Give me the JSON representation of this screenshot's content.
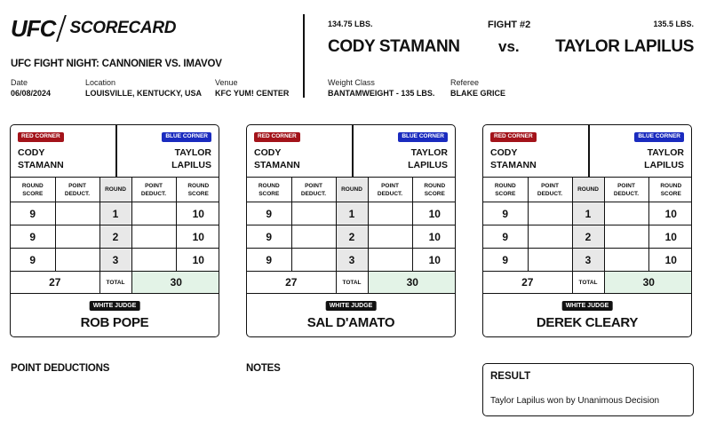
{
  "brand": {
    "logo": "UFC",
    "section": "SCORECARD"
  },
  "event": {
    "title": "UFC FIGHT NIGHT: CANNONIER VS. IMAVOV",
    "date_label": "Date",
    "date": "06/08/2024",
    "location_label": "Location",
    "location": "LOUISVILLE, KENTUCKY, USA",
    "venue_label": "Venue",
    "venue": "KFC YUM! CENTER"
  },
  "fight": {
    "number": "FIGHT #2",
    "vs": "vs.",
    "red": {
      "name": "CODY STAMANN",
      "weight": "134.75 LBS."
    },
    "blue": {
      "name": "TAYLOR LAPILUS",
      "weight": "135.5 LBS."
    },
    "weight_class_label": "Weight Class",
    "weight_class": "BANTAMWEIGHT - 135 LBS.",
    "referee_label": "Referee",
    "referee": "BLAKE GRICE"
  },
  "labels": {
    "red_corner": "RED CORNER",
    "blue_corner": "BLUE CORNER",
    "red_first": "CODY",
    "red_last": "STAMANN",
    "blue_first": "TAYLOR",
    "blue_last": "LAPILUS",
    "round_score_1": "ROUND",
    "round_score_2": "SCORE",
    "point_deduct_1": "POINT",
    "point_deduct_2": "DEDUCT.",
    "round": "ROUND",
    "total": "TOTAL",
    "white_judge": "WHITE JUDGE"
  },
  "cards": [
    {
      "judge": "ROB POPE",
      "rounds": [
        {
          "red": "9",
          "red_ded": "",
          "round": "1",
          "blue_ded": "",
          "blue": "10"
        },
        {
          "red": "9",
          "red_ded": "",
          "round": "2",
          "blue_ded": "",
          "blue": "10"
        },
        {
          "red": "9",
          "red_ded": "",
          "round": "3",
          "blue_ded": "",
          "blue": "10"
        }
      ],
      "red_total": "27",
      "blue_total": "30"
    },
    {
      "judge": "SAL D'AMATO",
      "rounds": [
        {
          "red": "9",
          "red_ded": "",
          "round": "1",
          "blue_ded": "",
          "blue": "10"
        },
        {
          "red": "9",
          "red_ded": "",
          "round": "2",
          "blue_ded": "",
          "blue": "10"
        },
        {
          "red": "9",
          "red_ded": "",
          "round": "3",
          "blue_ded": "",
          "blue": "10"
        }
      ],
      "red_total": "27",
      "blue_total": "30"
    },
    {
      "judge": "DEREK CLEARY",
      "rounds": [
        {
          "red": "9",
          "red_ded": "",
          "round": "1",
          "blue_ded": "",
          "blue": "10"
        },
        {
          "red": "9",
          "red_ded": "",
          "round": "2",
          "blue_ded": "",
          "blue": "10"
        },
        {
          "red": "9",
          "red_ded": "",
          "round": "3",
          "blue_ded": "",
          "blue": "10"
        }
      ],
      "red_total": "27",
      "blue_total": "30"
    }
  ],
  "point_deductions_title": "POINT DEDUCTIONS",
  "notes_title": "NOTES",
  "result": {
    "title": "RESULT",
    "text": "Taylor Lapilus won by Unanimous Decision"
  },
  "colors": {
    "red_corner": "#a3131a",
    "blue_corner": "#1a2bbf",
    "blue_total_bg": "#e3f3e7",
    "round_bg": "#e8e8e8"
  }
}
